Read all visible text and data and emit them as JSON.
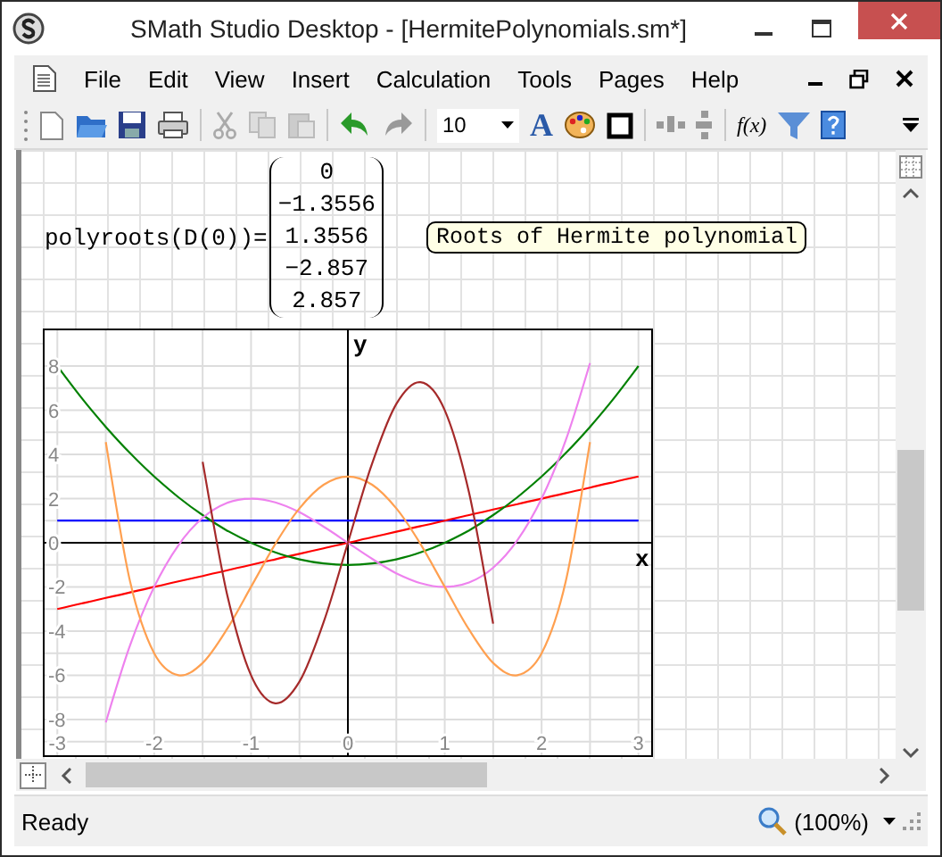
{
  "window": {
    "title": "SMath Studio Desktop - [HermitePolynomials.sm*]"
  },
  "menu": [
    "File",
    "Edit",
    "View",
    "Insert",
    "Calculation",
    "Tools",
    "Pages",
    "Help"
  ],
  "toolbar": {
    "font_size": "10",
    "font_color_label": "A",
    "function_label": "f(x)"
  },
  "expression": {
    "lhs": "polyroots(D(0))=",
    "result": [
      "0",
      "−1.3556",
      "1.3556",
      "−2.857",
      "2.857"
    ]
  },
  "comment": "Roots of Hermite polynomial",
  "chart_data": {
    "type": "line",
    "grid": true,
    "xlabel": "x",
    "ylabel": "y",
    "xlim": [
      -3.15,
      3.15
    ],
    "ylim": [
      -9.7,
      9.7
    ],
    "xticks": [
      -3,
      -2,
      -1,
      0,
      1,
      2,
      3
    ],
    "yticks": [
      -8,
      -6,
      -4,
      -2,
      0,
      2,
      4,
      6,
      8
    ],
    "x": [
      -3,
      -2.75,
      -2.5,
      -2.25,
      -2,
      -1.75,
      -1.5,
      -1.25,
      -1,
      -0.75,
      -0.5,
      -0.25,
      0,
      0.25,
      0.5,
      0.75,
      1,
      1.25,
      1.5,
      1.75,
      2,
      2.25,
      2.5,
      2.75,
      3
    ],
    "series": [
      {
        "color": "#0000ff",
        "values": [
          1,
          1,
          1,
          1,
          1,
          1,
          1,
          1,
          1,
          1,
          1,
          1,
          1,
          1,
          1,
          1,
          1,
          1,
          1,
          1,
          1,
          1,
          1,
          1,
          1
        ]
      },
      {
        "color": "#ff0000",
        "values": [
          -3,
          -2.75,
          -2.5,
          -2.25,
          -2,
          -1.75,
          -1.5,
          -1.25,
          -1,
          -0.75,
          -0.5,
          -0.25,
          0,
          0.25,
          0.5,
          0.75,
          1,
          1.25,
          1.5,
          1.75,
          2,
          2.25,
          2.5,
          2.75,
          3
        ]
      },
      {
        "color": "#008000",
        "values": [
          8,
          6.56,
          5.25,
          4.06,
          3,
          2.06,
          1.25,
          0.56,
          0,
          -0.44,
          -0.75,
          -0.94,
          -1,
          -0.94,
          -0.75,
          -0.44,
          0,
          0.56,
          1.25,
          2.06,
          3,
          4.06,
          5.25,
          6.56,
          8
        ]
      },
      {
        "color": "#ee82ee",
        "values": [
          null,
          null,
          -8.13,
          -4.64,
          -2,
          -0.11,
          1.13,
          1.8,
          2,
          1.83,
          1.38,
          0.73,
          0,
          -0.73,
          -1.38,
          -1.83,
          -2,
          -1.8,
          -1.13,
          0.11,
          2,
          4.64,
          8.13,
          null,
          null
        ]
      },
      {
        "color": "#ffa050",
        "values": [
          null,
          null,
          4.56,
          -1.75,
          -5,
          -6,
          -5.44,
          -3.93,
          -2,
          -0.06,
          1.56,
          2.63,
          3,
          2.63,
          1.56,
          -0.06,
          -2,
          -3.93,
          -5.44,
          -6,
          -5,
          -1.75,
          4.56,
          null,
          null
        ]
      },
      {
        "color": "#a52a2a",
        "values": [
          null,
          null,
          null,
          null,
          null,
          null,
          3.66,
          -2.27,
          -6,
          -7.27,
          -6.28,
          -3.59,
          0,
          3.59,
          6.28,
          7.27,
          6,
          2.27,
          -3.66,
          null,
          null,
          null,
          null,
          null,
          null
        ]
      }
    ]
  },
  "status_bar": {
    "text": "Ready",
    "zoom": "(100%)"
  }
}
